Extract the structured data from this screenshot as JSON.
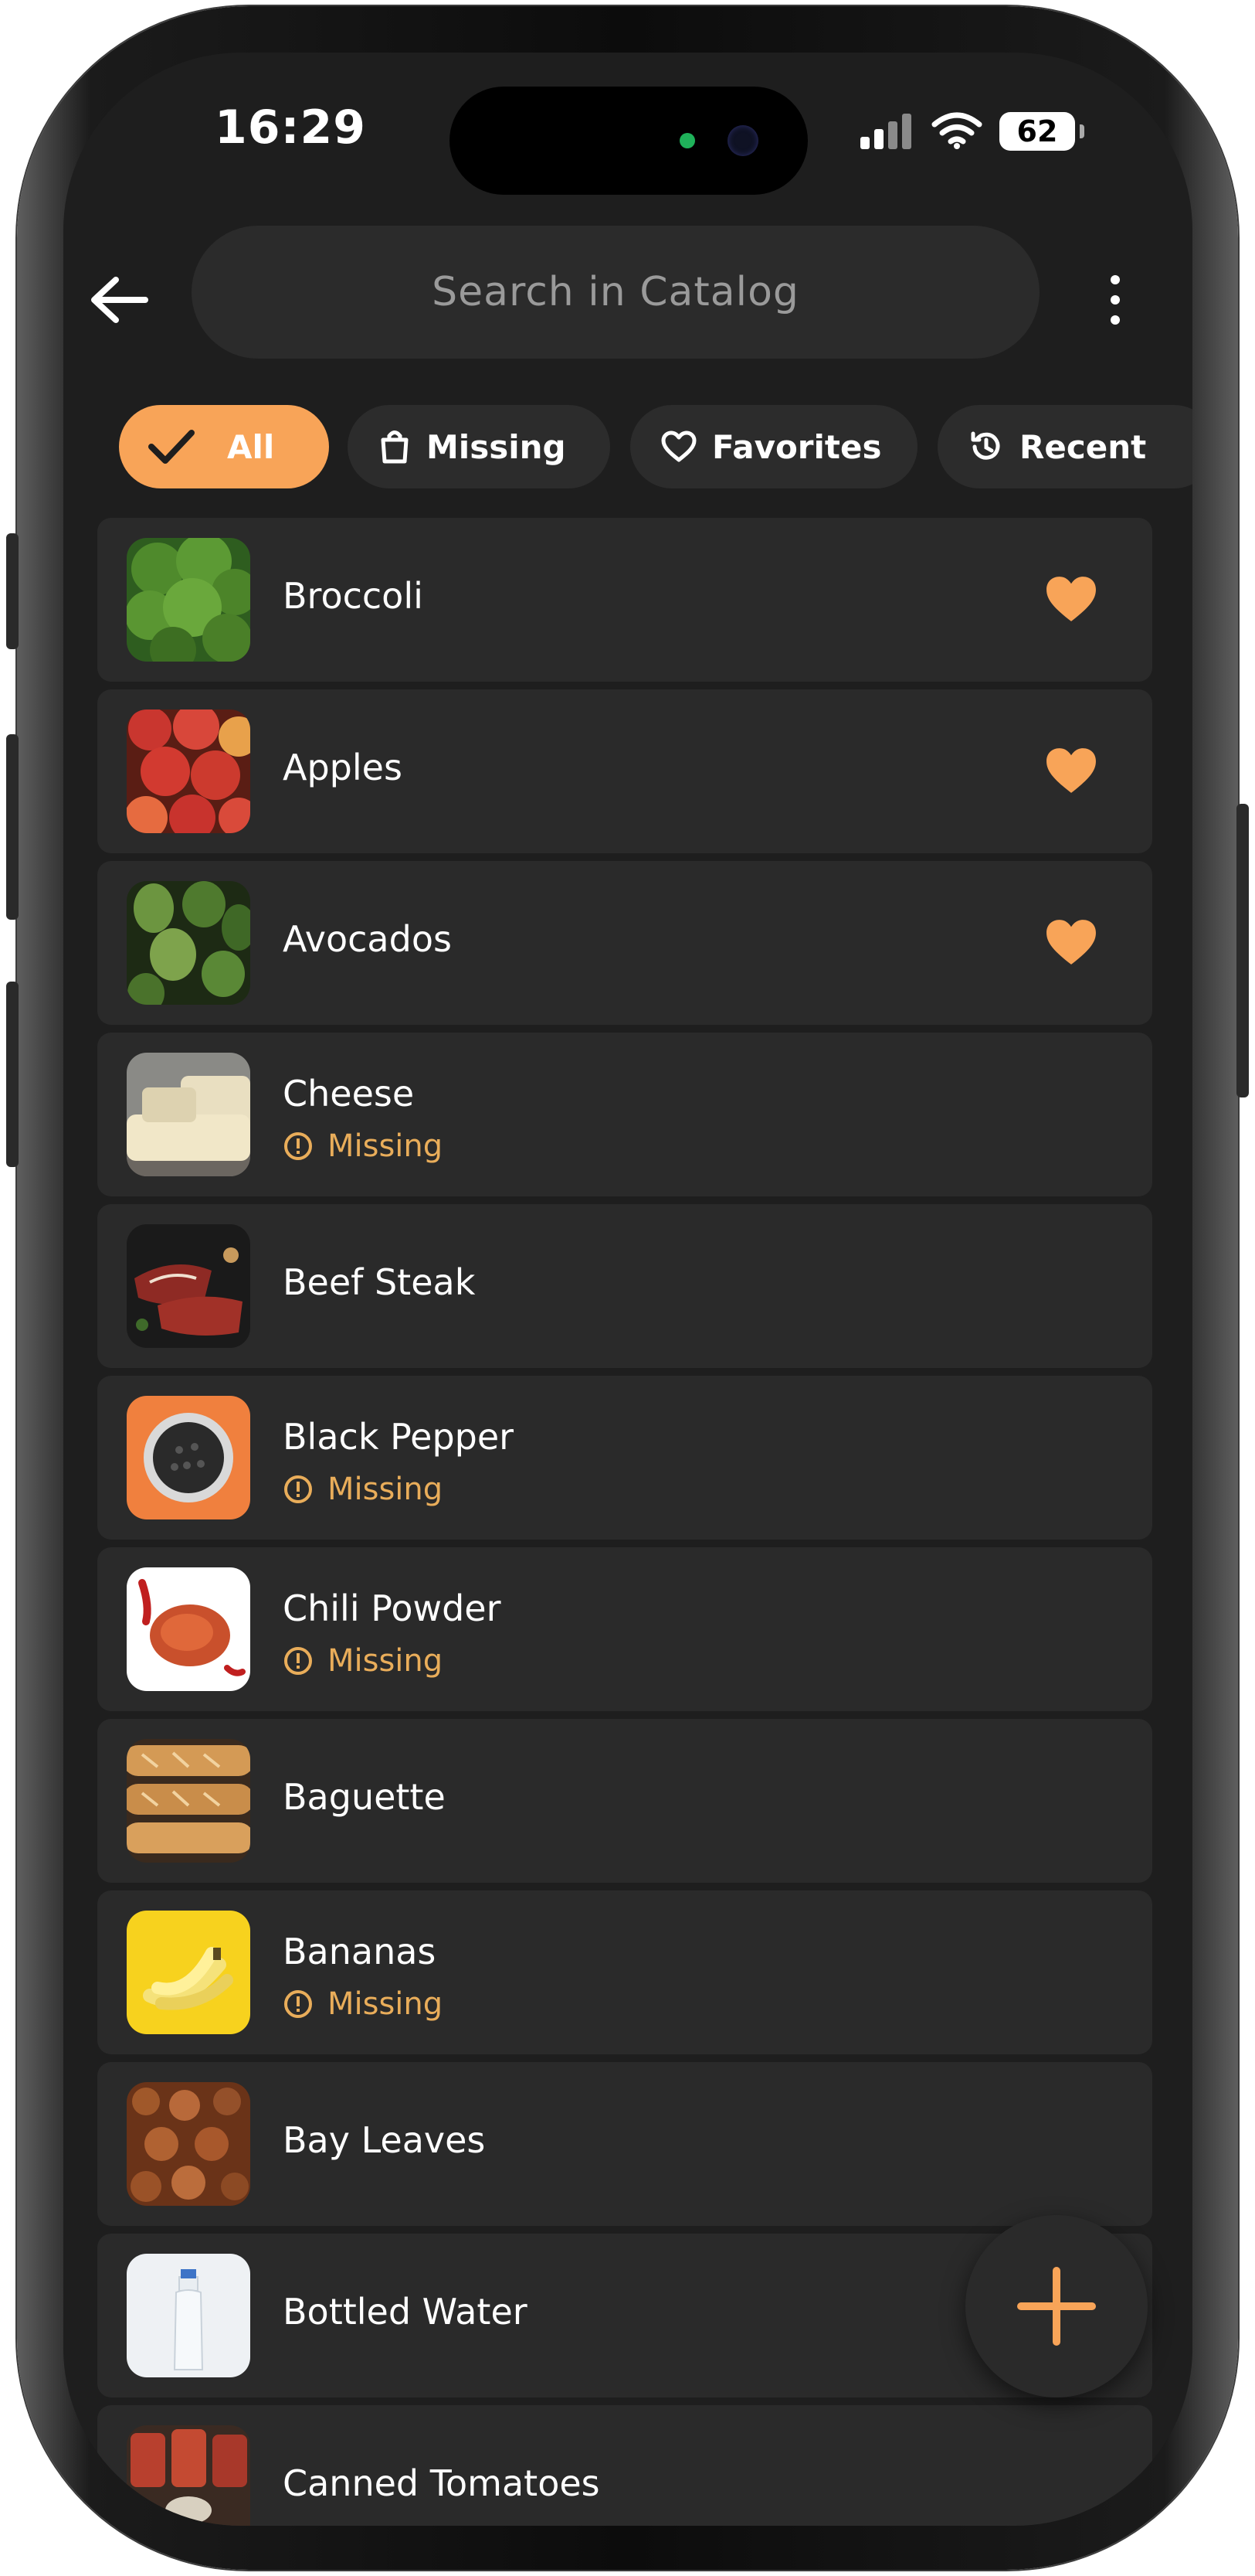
{
  "status_bar": {
    "time": "16:29",
    "battery": "62"
  },
  "search": {
    "placeholder": "Search in Catalog"
  },
  "filters": [
    {
      "label": "All",
      "icon": "check-icon",
      "active": true
    },
    {
      "label": "Missing",
      "icon": "shopping-bag-icon",
      "active": false
    },
    {
      "label": "Favorites",
      "icon": "heart-outline-icon",
      "active": false
    },
    {
      "label": "Recent",
      "icon": "history-icon",
      "active": false
    }
  ],
  "items": [
    {
      "name": "Broccoli",
      "favorite": true,
      "missing": false
    },
    {
      "name": "Apples",
      "favorite": true,
      "missing": false
    },
    {
      "name": "Avocados",
      "favorite": true,
      "missing": false
    },
    {
      "name": "Cheese",
      "favorite": false,
      "missing": true
    },
    {
      "name": "Beef Steak",
      "favorite": false,
      "missing": false
    },
    {
      "name": "Black Pepper",
      "favorite": false,
      "missing": true
    },
    {
      "name": "Chili Powder",
      "favorite": false,
      "missing": true
    },
    {
      "name": "Baguette",
      "favorite": false,
      "missing": false
    },
    {
      "name": "Bananas",
      "favorite": false,
      "missing": true
    },
    {
      "name": "Bay Leaves",
      "favorite": false,
      "missing": false
    },
    {
      "name": "Bottled Water",
      "favorite": false,
      "missing": false
    },
    {
      "name": "Canned Tomatoes",
      "favorite": false,
      "missing": false
    }
  ],
  "missing_label": "Missing",
  "colors": {
    "accent": "#f8a458",
    "missing": "#e9ad5a",
    "background": "#1e1e1e",
    "card": "#2a2a2a"
  }
}
